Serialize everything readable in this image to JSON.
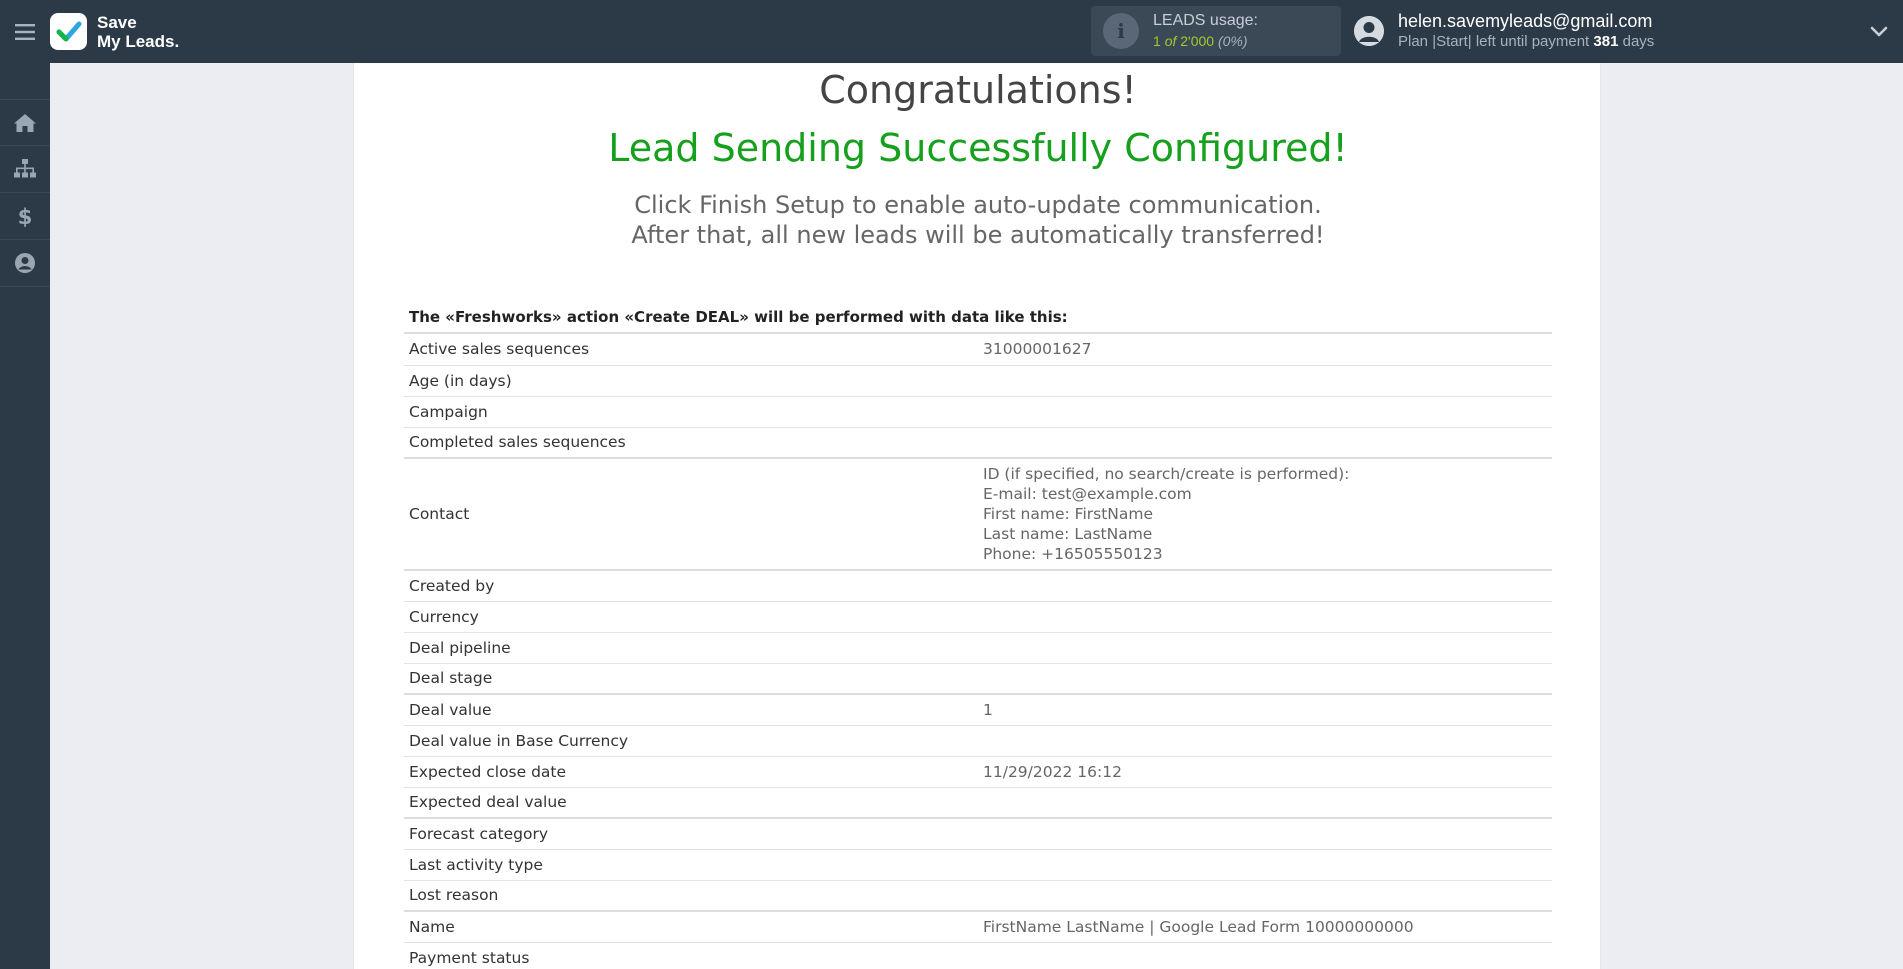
{
  "header": {
    "logo_line1": "Save",
    "logo_line2": "My Leads.",
    "usage_title": "LEADS usage:",
    "usage_used": "1",
    "usage_of": "of",
    "usage_total": "2'000",
    "usage_pct": "(0%)",
    "account_email": "helen.savemyleads@gmail.com",
    "plan_prefix": "Plan |Start| left until payment",
    "plan_days": "381",
    "plan_suffix": "days"
  },
  "sidebar": {
    "items": [
      {
        "icon": "home-icon"
      },
      {
        "icon": "sitemap-icon"
      },
      {
        "icon": "dollar-icon"
      },
      {
        "icon": "user-icon"
      }
    ]
  },
  "main": {
    "congrats": "Congratulations!",
    "success": "Lead Sending Successfully Configured!",
    "sub_line1": "Click Finish Setup to enable auto-update communication.",
    "sub_line2": "After that, all new leads will be automatically transferred!",
    "table_caption": "The «Freshworks» action «Create DEAL» will be performed with data like this:",
    "rows": [
      {
        "key": "Active sales sequences",
        "value": "31000001627"
      },
      {
        "key": "Age (in days)",
        "value": ""
      },
      {
        "key": "Campaign",
        "value": ""
      },
      {
        "key": "Completed sales sequences",
        "value": ""
      },
      {
        "key": "Contact",
        "lines": [
          "ID (if specified, no search/create is performed):",
          "E-mail: test@example.com",
          "First name: FirstName",
          "Last name: LastName",
          "Phone: +16505550123"
        ]
      },
      {
        "key": "Created by",
        "value": ""
      },
      {
        "key": "Currency",
        "value": ""
      },
      {
        "key": "Deal pipeline",
        "value": ""
      },
      {
        "key": "Deal stage",
        "value": ""
      },
      {
        "key": "Deal value",
        "value": "1"
      },
      {
        "key": "Deal value in Base Currency",
        "value": ""
      },
      {
        "key": "Expected close date",
        "value": "11/29/2022 16:12"
      },
      {
        "key": "Expected deal value",
        "value": ""
      },
      {
        "key": "Forecast category",
        "value": ""
      },
      {
        "key": "Last activity type",
        "value": ""
      },
      {
        "key": "Lost reason",
        "value": ""
      },
      {
        "key": "Name",
        "value": "FirstName LastName | Google Lead Form 10000000000"
      },
      {
        "key": "Payment status",
        "value": ""
      }
    ]
  },
  "colors": {
    "topbar": "#2c3a47",
    "success_green": "#15a01d",
    "usage_green": "#9fcc2e"
  }
}
